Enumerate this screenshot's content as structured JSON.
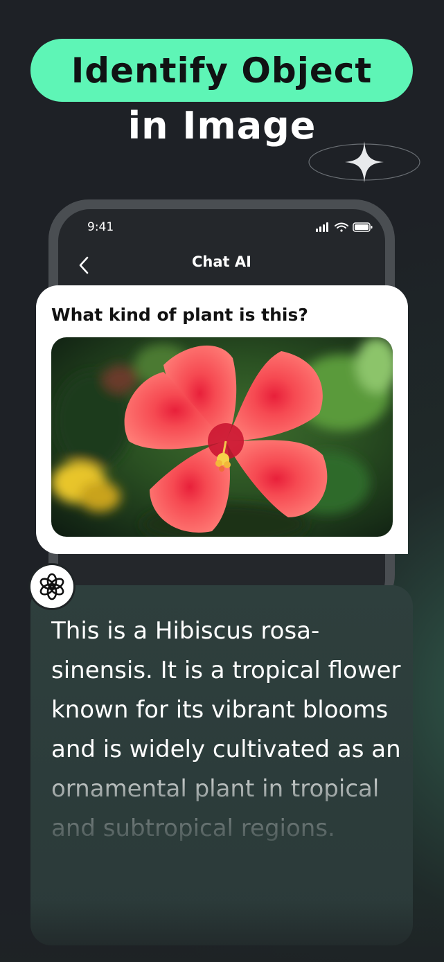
{
  "headline": {
    "line1": "Identify Object",
    "line2": "in Image",
    "accent_color": "#5ef5b6"
  },
  "status_bar": {
    "time": "9:41",
    "icons": [
      "signal-icon",
      "wifi-icon",
      "battery-icon"
    ]
  },
  "nav": {
    "back_icon": "chevron-left-icon",
    "title": "Chat AI"
  },
  "question": {
    "text": "What kind of plant is this?",
    "image": "hibiscus-flower-photo"
  },
  "answer": {
    "avatar_icon": "ai-logo-icon",
    "text": "This is a Hibiscus rosa-sinensis. It is a tropical flower known for its vibrant blooms and is widely cultivated as an ornamental plant in tropical and subtropical regions."
  }
}
